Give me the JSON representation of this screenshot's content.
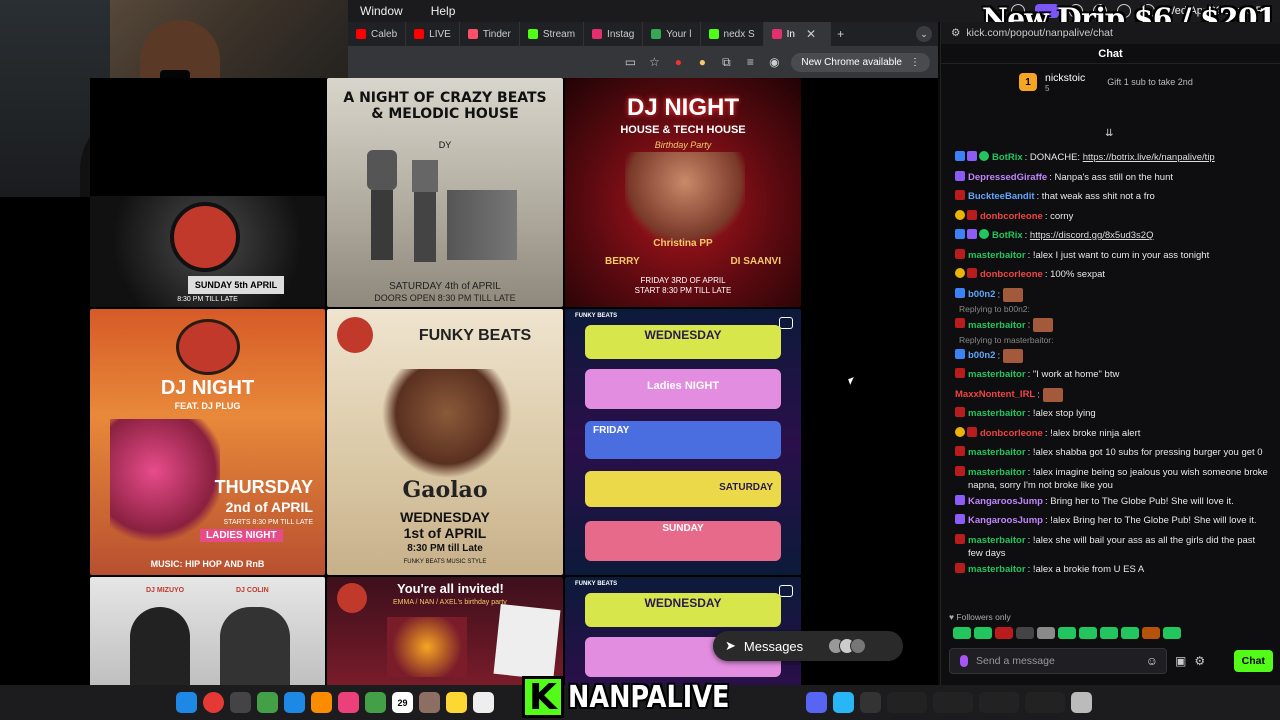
{
  "menubar": {
    "menus": [
      "Window",
      "Help"
    ],
    "clock": "Wed Apr 29  10:29 PM"
  },
  "overlay": {
    "promo_text": "New Drip $6 / $201"
  },
  "browser": {
    "tabs": [
      {
        "label": "Caleb",
        "fav_color": "#ff0000",
        "active": false
      },
      {
        "label": "LIVE",
        "fav_color": "#ff0000",
        "active": false
      },
      {
        "label": "Tinder",
        "fav_color": "#fd5068",
        "active": false
      },
      {
        "label": "Stream",
        "fav_color": "#53fc18",
        "active": false
      },
      {
        "label": "Instag",
        "fav_color": "#e1306c",
        "active": false
      },
      {
        "label": "Your l",
        "fav_color": "#34a853",
        "active": false
      },
      {
        "label": "nedx S",
        "fav_color": "#53fc18",
        "active": false
      },
      {
        "label": "In",
        "fav_color": "#e1306c",
        "active": true
      }
    ],
    "update_button": "New Chrome available"
  },
  "posts": {
    "p1": {
      "title": "",
      "line1": "SUNDAY 5th APRIL",
      "line2": "8:30 PM TILL LATE"
    },
    "p2": {
      "title": "A NIGHT OF CRAZY BEATS & MELODIC HOUSE",
      "brand": "DY",
      "line1": "SATURDAY 4th of APRIL",
      "line2": "DOORS OPEN 8:30 PM TILL LATE"
    },
    "p3": {
      "title": "DJ NIGHT",
      "subtitle": "HOUSE & TECH HOUSE",
      "script": "Birthday Party",
      "name_center": "Christina PP",
      "name_left": "BERRY",
      "name_right": "DI SAANVI",
      "line1": "FRIDAY 3RD OF APRIL",
      "line2": "START 8:30 PM TILL LATE"
    },
    "p4": {
      "title": "DJ NIGHT",
      "feat": "FEAT. DJ PLUG",
      "day": "THURSDAY",
      "date": "2nd of APRIL",
      "starts": "STARTS 8:30 PM TILL LATE",
      "ladies": "LADIES NIGHT",
      "music": "MUSIC: HIP HOP AND RnB"
    },
    "p5": {
      "title": "FUNKY BEATS",
      "name": "Gaolao",
      "day": "WEDNESDAY",
      "date": "1st of APRIL",
      "time": "8:30 PM till Late",
      "footer": "FUNKY BEATS MUSIC STYLE"
    },
    "p6": {
      "header": "FUNKY BEATS",
      "row1": "WEDNESDAY",
      "row2": "Ladies NIGHT",
      "row3": "FRIDAY",
      "row4": "SATURDAY",
      "row5": "SUNDAY"
    },
    "p7": {
      "left": "DJ MIZUYO",
      "right": "DJ COLIN"
    },
    "p8": {
      "title": "You're all invited!",
      "sub": "EMMA / NAN / AXEL's birthday party"
    },
    "p9": {
      "header": "FUNKY BEATS",
      "row1": "WEDNESDAY"
    }
  },
  "messages_pill": {
    "label": "Messages"
  },
  "chat": {
    "url": "kick.com/popout/nanpalive/chat",
    "header": "Chat",
    "gifter": {
      "rank": "1",
      "name": "nickstoic",
      "count": "5",
      "cta": "Gift 1 sub to take 2nd"
    },
    "messages": [
      {
        "user": "BotRix",
        "color": "#22c55e",
        "badges": [
          "blue",
          "purple",
          "green"
        ],
        "text": "DONACHE: ",
        "link": "https://botrix.live/k/nanpalive/tip"
      },
      {
        "user": "DepressedGiraffe",
        "color": "#c084fc",
        "badges": [
          "purple"
        ],
        "text": "Nanpa's ass still on the hunt"
      },
      {
        "user": "BuckteeBandit",
        "color": "#60a5fa",
        "badges": [
          "red"
        ],
        "text": "that weak ass shit not a fro"
      },
      {
        "user": "donbcorleone",
        "color": "#ef4444",
        "badges": [
          "gold",
          "red"
        ],
        "text": "corny"
      },
      {
        "user": "BotRix",
        "color": "#22c55e",
        "badges": [
          "blue",
          "purple",
          "green"
        ],
        "text": "",
        "link": "https://discord.gg/8x5ud3s2Q"
      },
      {
        "user": "masterbaitor",
        "color": "#22c55e",
        "badges": [
          "red"
        ],
        "text": "!alex I just want to cum in your ass tonight"
      },
      {
        "user": "donbcorleone",
        "color": "#ef4444",
        "badges": [
          "gold",
          "red"
        ],
        "text": "100% sexpat"
      },
      {
        "user": "b00n2",
        "color": "#60a5fa",
        "badges": [
          "blue"
        ],
        "text": "",
        "emote": true
      },
      {
        "reply": "Replying to b00n2:"
      },
      {
        "user": "masterbaitor",
        "color": "#22c55e",
        "badges": [
          "red"
        ],
        "text": "",
        "emote": true
      },
      {
        "reply": "Replying to masterbaitor:"
      },
      {
        "user": "b00n2",
        "color": "#60a5fa",
        "badges": [
          "blue"
        ],
        "text": "",
        "emote": true
      },
      {
        "user": "masterbaitor",
        "color": "#22c55e",
        "badges": [
          "red"
        ],
        "text": "\"I work at home\" btw"
      },
      {
        "user": "MaxxNontent_IRL",
        "color": "#ef4444",
        "badges": [],
        "text": "",
        "emote": true
      },
      {
        "user": "masterbaitor",
        "color": "#22c55e",
        "badges": [
          "red"
        ],
        "text": "!alex stop lying"
      },
      {
        "user": "donbcorleone",
        "color": "#ef4444",
        "badges": [
          "gold",
          "red"
        ],
        "text": "!alex broke ninja alert"
      },
      {
        "user": "masterbaitor",
        "color": "#22c55e",
        "badges": [
          "red"
        ],
        "text": "!alex shabba got 10 subs for pressing burger you get 0"
      },
      {
        "user": "masterbaitor",
        "color": "#22c55e",
        "badges": [
          "red"
        ],
        "text": "!alex imagine being so jealous you wish someone broke napna, sorry I'm not broke like you"
      },
      {
        "user": "KangaroosJump",
        "color": "#c084fc",
        "badges": [
          "purple"
        ],
        "text": "Bring her to The Globe Pub! She will love it."
      },
      {
        "user": "KangaroosJump",
        "color": "#c084fc",
        "badges": [
          "purple"
        ],
        "text": "!alex Bring her to The Globe Pub! She will love it."
      },
      {
        "user": "masterbaitor",
        "color": "#22c55e",
        "badges": [
          "red"
        ],
        "text": "!alex she will bail your ass as all the girls did the past few days"
      },
      {
        "user": "masterbaitor",
        "color": "#22c55e",
        "badges": [
          "red"
        ],
        "text": "!alex a brokie from U ES A"
      }
    ],
    "followers_only": "Followers only",
    "input_placeholder": "Send a message",
    "send_button": "Chat"
  },
  "dock": {
    "calendar_day": "29"
  },
  "stream_brand": {
    "letter": "K",
    "name": "NANPALIVE"
  }
}
